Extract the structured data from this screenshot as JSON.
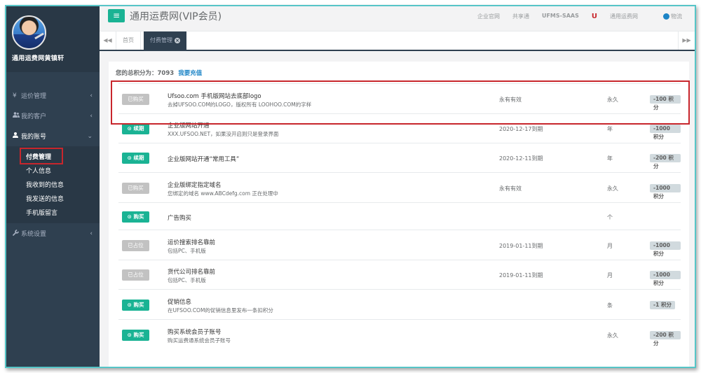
{
  "sidebar": {
    "profile_name": "通用运费网黄镇轩",
    "items": [
      {
        "label": "运价管理",
        "icon": "yen-icon"
      },
      {
        "label": "我的客户",
        "icon": "users-icon"
      },
      {
        "label": "我的账号",
        "icon": "user-icon"
      },
      {
        "label": "系统设置",
        "icon": "wrench-icon"
      }
    ],
    "submenu": [
      "付费管理",
      "个人信息",
      "我收到的信息",
      "我发送的信息",
      "手机版留言"
    ]
  },
  "header": {
    "title": "通用运费网(VIP会员)",
    "links": [
      "企业官网",
      "共享通",
      "UFMS-SAAS",
      "通用运费网",
      "物流"
    ]
  },
  "tabs": {
    "home": "首页",
    "active": "付费管理"
  },
  "content": {
    "points_label": "您的总积分为：",
    "points_value": "7093",
    "recharge": "我要充值",
    "rows": [
      {
        "button": "已购买",
        "button_style": "grey",
        "name": "Ufsoo.com 手机版网站去底部logo",
        "desc": "去掉UFSOO.COM的LOGO，版权所有 LOOHOO.COM的字样",
        "expiry": "永有有效",
        "period": "永久",
        "cost": "-100 积分"
      },
      {
        "button": "续期",
        "button_style": "green",
        "name": "企业版网站开通",
        "desc": "XXX.UFSOO.NET，如果没开启则只是登录界面",
        "expiry": "2020-12-17到期",
        "period": "年",
        "cost": "-1000 积分"
      },
      {
        "button": "续期",
        "button_style": "green",
        "name": "企业版网站开通“常用工具”",
        "desc": "",
        "expiry": "2020-12-11到期",
        "period": "年",
        "cost": "-200 积分"
      },
      {
        "button": "已购买",
        "button_style": "grey",
        "name": "企业版绑定指定域名",
        "desc": "您绑定的域名 www.ABCdefg.com 正在处理中",
        "expiry": "永有有效",
        "period": "永久",
        "cost": "-1000 积分"
      },
      {
        "button": "购买",
        "button_style": "green",
        "name": "广告购买",
        "desc": "",
        "expiry": "",
        "period": "个",
        "cost": ""
      },
      {
        "button": "已占位",
        "button_style": "grey",
        "name": "运价搜索排名靠前",
        "desc": "包括PC、手机版",
        "expiry": "2019-01-11到期",
        "period": "月",
        "cost": "-1000 积分"
      },
      {
        "button": "已占位",
        "button_style": "grey",
        "name": "货代公司排名靠前",
        "desc": "包括PC、手机版",
        "expiry": "2019-01-11到期",
        "period": "月",
        "cost": "-1000 积分"
      },
      {
        "button": "购买",
        "button_style": "green",
        "name": "促销信息",
        "desc": "在UFSOO.COM的促销信息里发布一条扣积分",
        "expiry": "",
        "period": "条",
        "cost": "-1 积分"
      },
      {
        "button": "购买",
        "button_style": "green",
        "name": "购买系统会员子账号",
        "desc": "购买运费通系统会员子账号",
        "expiry": "",
        "period": "永久",
        "cost": "-200 积分"
      }
    ]
  },
  "colors": {
    "sidebar": "#2f4050",
    "accent": "#1ab394",
    "highlight": "#c8262c",
    "link": "#1c84c6"
  }
}
